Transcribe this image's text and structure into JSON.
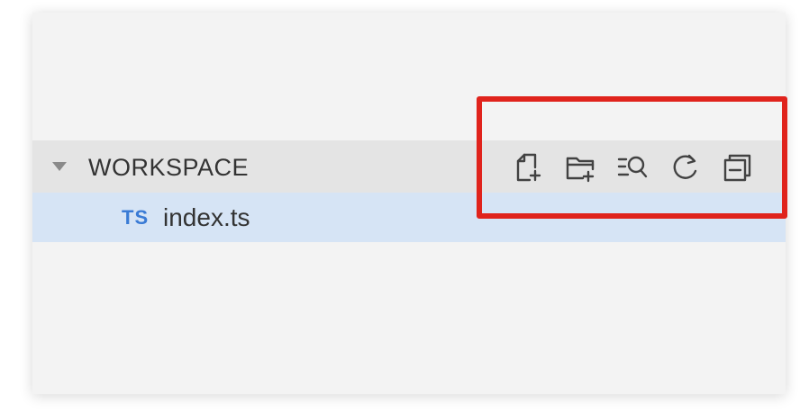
{
  "explorer": {
    "section_title": "WORKSPACE",
    "toolbar": {
      "actions": [
        {
          "icon": "new-file-icon"
        },
        {
          "icon": "new-folder-icon"
        },
        {
          "icon": "search-list-icon"
        },
        {
          "icon": "refresh-icon"
        },
        {
          "icon": "collapse-all-icon"
        }
      ]
    },
    "files": [
      {
        "badge": "TS",
        "name": "index.ts"
      }
    ]
  },
  "colors": {
    "panel_bg": "#f3f3f3",
    "header_bg": "#e4e4e4",
    "selected_row_bg": "#d6e4f5",
    "ts_badge": "#3a7bd5",
    "highlight": "#e0231c"
  }
}
